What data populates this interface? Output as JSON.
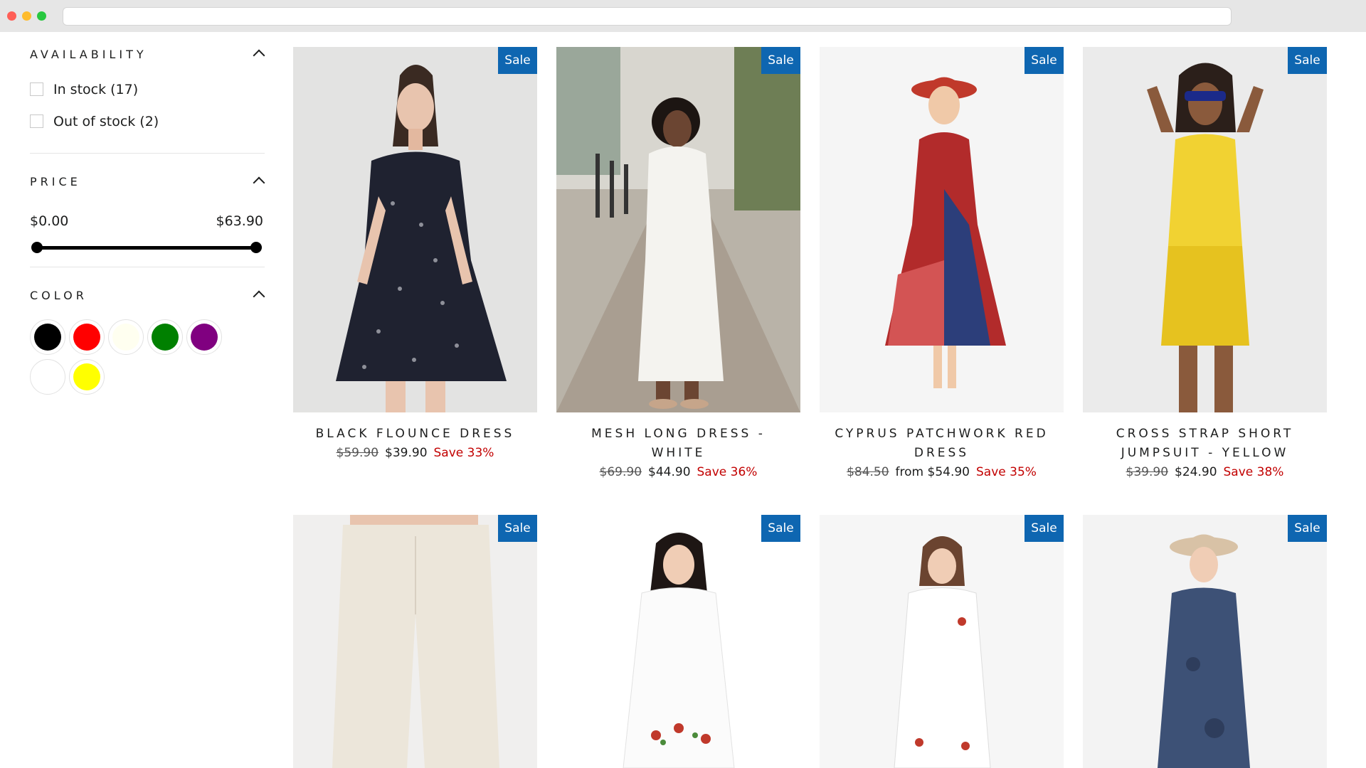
{
  "filters": {
    "availability": {
      "title": "AVAILABILITY",
      "options": [
        {
          "label": "In stock (17)"
        },
        {
          "label": "Out of stock (2)"
        }
      ]
    },
    "price": {
      "title": "PRICE",
      "min_label": "$0.00",
      "max_label": "$63.90"
    },
    "color": {
      "title": "COLOR",
      "swatches": [
        "#000000",
        "#ff0000",
        "#fffff0",
        "#008000",
        "#800080",
        "#ffffff",
        "#ffff00"
      ]
    }
  },
  "products": [
    {
      "title": "BLACK FLOUNCE DRESS",
      "badge": "Sale",
      "old_price": "$59.90",
      "price": "$39.90",
      "save": "Save 33%"
    },
    {
      "title": "MESH LONG DRESS - WHITE",
      "badge": "Sale",
      "old_price": "$69.90",
      "price": "$44.90",
      "save": "Save 36%"
    },
    {
      "title": "CYPRUS PATCHWORK RED DRESS",
      "badge": "Sale",
      "old_price": "$84.50",
      "price": "from $54.90",
      "save": "Save 35%"
    },
    {
      "title": "CROSS STRAP SHORT JUMPSUIT - YELLOW",
      "badge": "Sale",
      "old_price": "$39.90",
      "price": "$24.90",
      "save": "Save 38%"
    },
    {
      "badge": "Sale"
    },
    {
      "badge": "Sale"
    },
    {
      "badge": "Sale"
    },
    {
      "badge": "Sale"
    }
  ]
}
